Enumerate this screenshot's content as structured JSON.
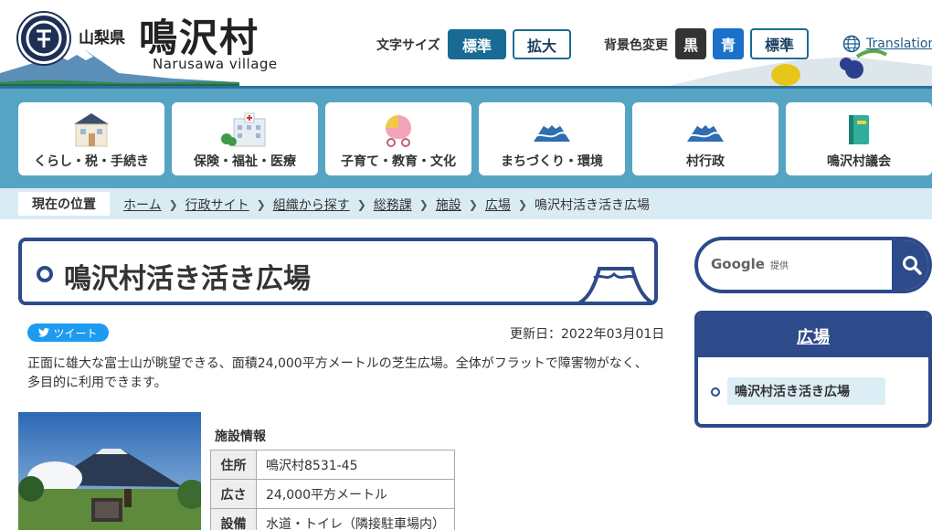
{
  "header": {
    "prefecture": "山梨県",
    "village_name": "鳴沢村",
    "village_name_en": "Narusawa village",
    "text_size_label": "文字サイズ",
    "text_size_standard": "標準",
    "text_size_large": "拡大",
    "bg_color_label": "背景色変更",
    "bg_black": "黒",
    "bg_blue": "青",
    "bg_standard": "標準",
    "translation": "Translation"
  },
  "nav": {
    "items": [
      {
        "label": "くらし・税・手続き",
        "icon": "house-icon"
      },
      {
        "label": "保険・福祉・医療",
        "icon": "hospital-icon"
      },
      {
        "label": "子育て・教育・文化",
        "icon": "stroller-icon"
      },
      {
        "label": "まちづくり・環境",
        "icon": "mount-fuji-icon"
      },
      {
        "label": "村行政",
        "icon": "mount-fuji-icon"
      },
      {
        "label": "鳴沢村議会",
        "icon": "book-icon"
      }
    ]
  },
  "breadcrumb": {
    "here_label": "現在の位置",
    "items": [
      "ホーム",
      "行政サイト",
      "組織から探す",
      "総務課",
      "施設",
      "広場"
    ],
    "current": "鳴沢村活き活き広場"
  },
  "main": {
    "title": "鳴沢村活き活き広場",
    "tweet": "ツイート",
    "updated": "更新日：2022年03月01日",
    "description": "正面に雄大な富士山が眺望できる、面積24,000平方メートルの芝生広場。全体がフラットで障害物がなく、多目的に利用できます。",
    "facility_caption": "施設情報",
    "facility": [
      {
        "key": "住所",
        "value": "鳴沢村8531-45"
      },
      {
        "key": "広さ",
        "value": "24,000平方メートル"
      },
      {
        "key": "設備",
        "value": "水道・トイレ（隣接駐車場内）"
      }
    ]
  },
  "sidebar": {
    "search_brand": "Google",
    "search_provided": "提供",
    "category_title": "広場",
    "link": "鳴沢村活き活き広場"
  },
  "colors": {
    "navy": "#2d4a8a",
    "nav_bg": "#56a4c3",
    "crumb_bg": "#d9ecf4",
    "accent_blue": "#1a6b93"
  }
}
